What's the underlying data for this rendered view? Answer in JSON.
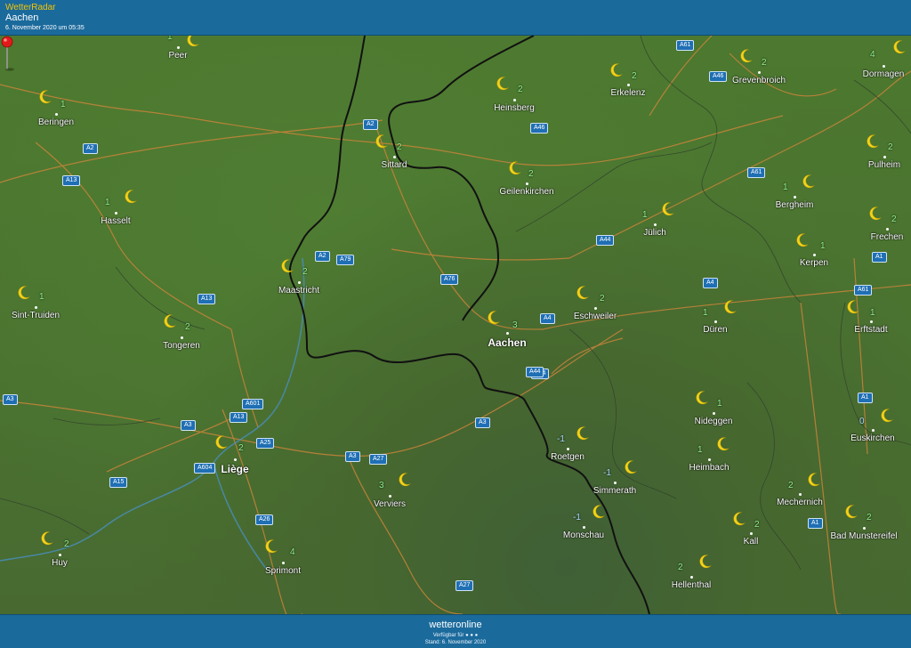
{
  "header": {
    "brand": "WetterRadar",
    "location": "Aachen",
    "timestamp": "6. November 2020 um 05:35"
  },
  "footer": {
    "logo": "wetteronline",
    "available": "Verfügbar für ● ● ●",
    "stand": "Stand: 6. November 2020"
  },
  "cities": [
    {
      "name": "Peer",
      "temp": "1"
    },
    {
      "name": "Beringen",
      "temp": "1"
    },
    {
      "name": "Hasselt",
      "temp": "1"
    },
    {
      "name": "Sint-Truiden",
      "temp": "1"
    },
    {
      "name": "Tongeren",
      "temp": "2"
    },
    {
      "name": "Liège",
      "temp": "2"
    },
    {
      "name": "Huy",
      "temp": "2"
    },
    {
      "name": "Sprimont",
      "temp": "4"
    },
    {
      "name": "Verviers",
      "temp": "3"
    },
    {
      "name": "Maastricht",
      "temp": "2"
    },
    {
      "name": "Sittard",
      "temp": "2"
    },
    {
      "name": "Heinsberg",
      "temp": "2"
    },
    {
      "name": "Geilenkirchen",
      "temp": "2"
    },
    {
      "name": "Erkelenz",
      "temp": "2"
    },
    {
      "name": "Grevenbroich",
      "temp": "2"
    },
    {
      "name": "Dormagen",
      "temp": "4"
    },
    {
      "name": "Pulheim",
      "temp": "2"
    },
    {
      "name": "Bergheim",
      "temp": "1"
    },
    {
      "name": "Frechen",
      "temp": "2"
    },
    {
      "name": "Kerpen",
      "temp": "1"
    },
    {
      "name": "Jülich",
      "temp": "1"
    },
    {
      "name": "Aachen",
      "temp": "3"
    },
    {
      "name": "Eschweiler",
      "temp": "2"
    },
    {
      "name": "Düren",
      "temp": "1"
    },
    {
      "name": "Erftstadt",
      "temp": "1"
    },
    {
      "name": "Nideggen",
      "temp": "1"
    },
    {
      "name": "Euskirchen",
      "temp": "0"
    },
    {
      "name": "Roetgen",
      "temp": "-1"
    },
    {
      "name": "Heimbach",
      "temp": "1"
    },
    {
      "name": "Simmerath",
      "temp": "-1"
    },
    {
      "name": "Monschau",
      "temp": "-1"
    },
    {
      "name": "Mechernich",
      "temp": "2"
    },
    {
      "name": "Kall",
      "temp": "2"
    },
    {
      "name": "Bad Munstereifel",
      "temp": "2"
    },
    {
      "name": "Hellenthal",
      "temp": "2"
    }
  ],
  "roads": [
    "A61",
    "A46",
    "A46",
    "A2",
    "A2",
    "A13",
    "A2",
    "A79",
    "A76",
    "A44",
    "A61",
    "A44",
    "A4",
    "A1",
    "A61",
    "A4",
    "A13",
    "A3",
    "A601",
    "A13",
    "A3",
    "A25",
    "A604",
    "A3",
    "A27",
    "A15",
    "A3",
    "A26",
    "A27",
    "A1",
    "A1",
    "A44"
  ],
  "pin": {
    "color": "#e01a1a"
  },
  "colors": {
    "header": "#1b6a9c",
    "brand": "#f5c400",
    "temp": "#8ef08e",
    "moon": "#f2d21b"
  }
}
